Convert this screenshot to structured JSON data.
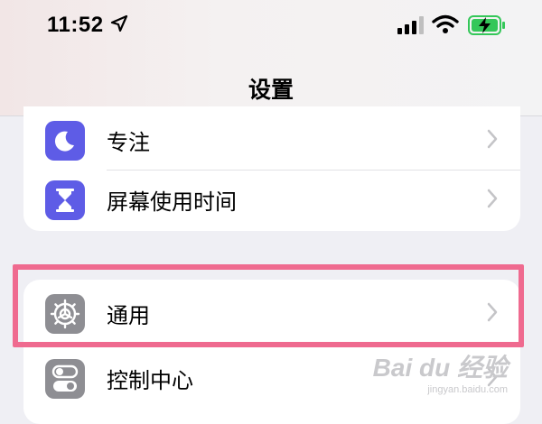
{
  "status_bar": {
    "time": "11:52",
    "icons": [
      "location-arrow-icon",
      "cellular-signal-icon",
      "wifi-icon",
      "battery-charging-icon"
    ]
  },
  "nav": {
    "title": "设置"
  },
  "groups": [
    {
      "items": [
        {
          "label": "专注",
          "icon": "moon-icon",
          "icon_color": "#5e5ce6"
        },
        {
          "label": "屏幕使用时间",
          "icon": "hourglass-icon",
          "icon_color": "#5e5ce6"
        }
      ]
    },
    {
      "items": [
        {
          "label": "通用",
          "icon": "gear-icon",
          "icon_color": "#8e8e93",
          "highlighted": true
        },
        {
          "label": "控制中心",
          "icon": "toggle-switches-icon",
          "icon_color": "#8e8e93"
        }
      ]
    }
  ],
  "colors": {
    "highlight": "#ef6a8f",
    "battery": "#34c759",
    "accent_purple": "#5e5ce6",
    "gray_icon": "#8e8e93"
  },
  "watermark": {
    "line1": "Bai du 经验",
    "line2": "jingyan.baidu.com"
  }
}
